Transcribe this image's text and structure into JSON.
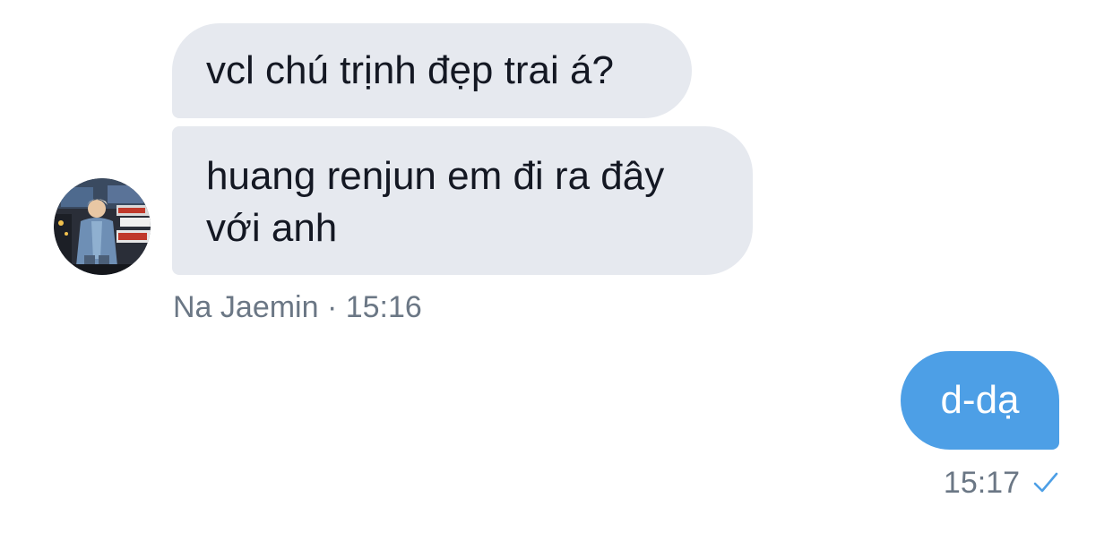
{
  "conversation": {
    "incoming": {
      "messages": [
        {
          "text": "vcl chú trịnh đẹp trai á?"
        },
        {
          "line1": "huang renjun em đi ra đây",
          "line2": "với anh"
        }
      ],
      "meta": "Na Jaemin · 15:16",
      "avatar_icon": "user-avatar-photo"
    },
    "outgoing": {
      "messages": [
        {
          "text": "d-dạ"
        }
      ],
      "time": "15:17",
      "status_icon": "sent-check-icon"
    }
  },
  "colors": {
    "incoming_bubble": "#e6e9ef",
    "outgoing_bubble": "#4d9fe6",
    "meta_text": "#6b7785",
    "check": "#4d9fe6"
  }
}
